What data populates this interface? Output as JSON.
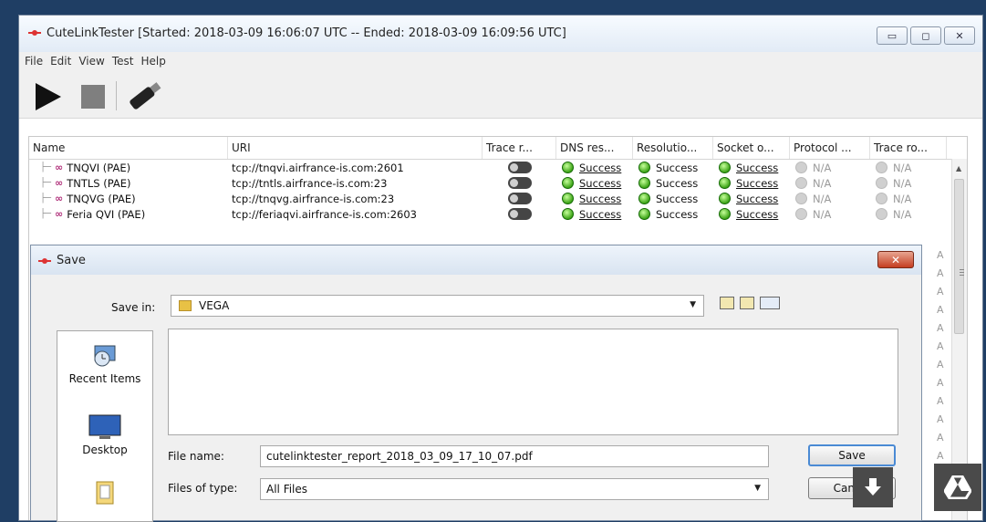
{
  "window": {
    "title": "CuteLinkTester [Started: 2018-03-09 16:06:07 UTC -- Ended: 2018-03-09 16:09:56 UTC]",
    "controls": [
      "minimize",
      "maximize",
      "close"
    ]
  },
  "menu": [
    "File",
    "Edit",
    "View",
    "Test",
    "Help"
  ],
  "toolbar": {
    "icons": [
      "play-icon",
      "stop-icon",
      "usb-stick-icon"
    ]
  },
  "table": {
    "columns": [
      "Name",
      "URI",
      "Trace r...",
      "DNS res...",
      "Resolutio...",
      "Socket o...",
      "Protocol ...",
      "Trace ro..."
    ],
    "rows": [
      {
        "name": "TNQVI (PAE)",
        "uri": "tcp://tnqvi.airfrance-is.com:2601",
        "dns": "Success",
        "resolution": "Success",
        "socket": "Success",
        "protocol": "N/A",
        "trace": "N/A"
      },
      {
        "name": "TNTLS (PAE)",
        "uri": "tcp://tntls.airfrance-is.com:23",
        "dns": "Success",
        "resolution": "Success",
        "socket": "Success",
        "protocol": "N/A",
        "trace": "N/A"
      },
      {
        "name": "TNQVG (PAE)",
        "uri": "tcp://tnqvg.airfrance-is.com:23",
        "dns": "Success",
        "resolution": "Success",
        "socket": "Success",
        "protocol": "N/A",
        "trace": "N/A"
      },
      {
        "name": "Feria QVI (PAE)",
        "uri": "tcp://feriaqvi.airfrance-is.com:2603",
        "dns": "Success",
        "resolution": "Success",
        "socket": "Success",
        "protocol": "N/A",
        "trace": "N/A"
      }
    ],
    "peek_text": "A"
  },
  "dialog": {
    "title": "Save",
    "save_in_label": "Save in:",
    "save_in_value": "VEGA",
    "places": [
      "Recent Items",
      "Desktop"
    ],
    "file_name_label": "File name:",
    "file_name_value": "cutelinktester_report_2018_03_09_17_10_07.pdf",
    "files_of_type_label": "Files of type:",
    "files_of_type_value": "All Files",
    "save_button": "Save",
    "cancel_button": "Cancel"
  },
  "overlay": {
    "icons": [
      "download-icon",
      "google-drive-icon"
    ]
  },
  "colors": {
    "desktop": "#1f3e64",
    "success_green": "#3ea518",
    "link_icon": "#b0307a",
    "close_red": "#c43d20"
  }
}
